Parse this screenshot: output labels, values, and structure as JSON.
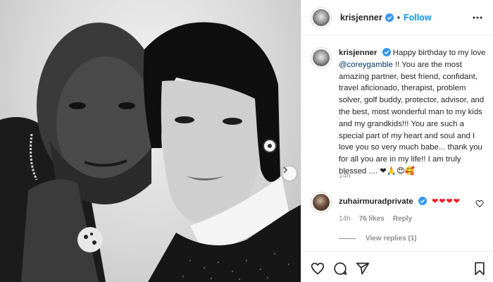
{
  "post": {
    "username": "krisjenner",
    "follow_label": "Follow",
    "separator": "•",
    "caption_text": "Happy birthday to my love",
    "caption_mention": "@coreygamble",
    "caption_rest": "!! You are the most amazing partner, best friend, confidant, travel aficionado, therapist, problem solver, golf buddy, protector, advisor, and the best, most wonderful man to my kids and my grandkids!!! You are such a special part of my heart and soul and I love you so very much babe... thank you for all you are in my life!! I am truly blessed ....",
    "caption_emojis": "❤🙏😍🥰",
    "caption_time": "14h"
  },
  "comment": {
    "username": "zuhairmuradprivate",
    "hearts": "❤❤❤❤",
    "time": "14h",
    "likes": "76 likes",
    "reply_label": "Reply",
    "view_replies": "View replies (1)"
  },
  "colors": {
    "accent": "#0095f6",
    "heart_red": "#ed1c24",
    "mention": "#00376b",
    "muted": "#8e8e8e"
  },
  "icons": [
    "verified-badge-icon",
    "more-options-icon",
    "heart-icon",
    "comment-icon",
    "share-icon",
    "bookmark-icon",
    "chevron-right-icon"
  ]
}
